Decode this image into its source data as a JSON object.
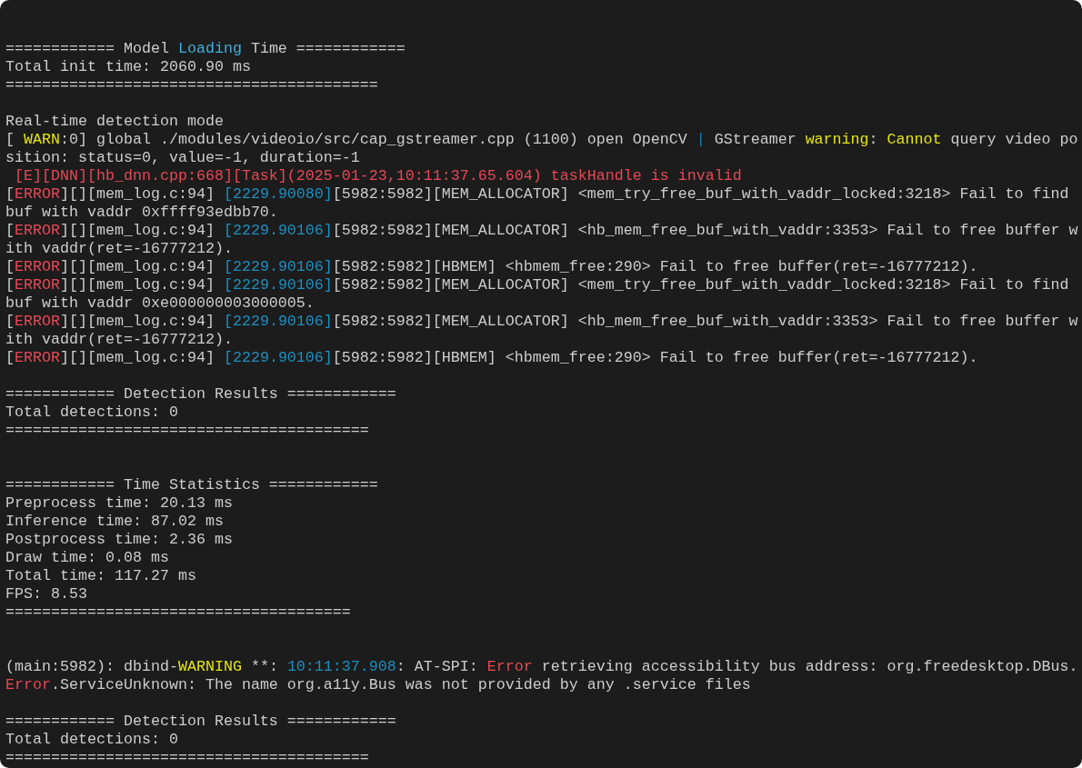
{
  "terminal": {
    "lines": [
      {
        "kind": "blank"
      },
      {
        "kind": "blank"
      },
      {
        "kind": "text",
        "segments": [
          {
            "text": "============ Model "
          },
          {
            "text": "Loading",
            "color": "#3fb0dc"
          },
          {
            "text": " Time ============"
          }
        ]
      },
      {
        "kind": "text",
        "segments": [
          {
            "text": "Total init time: 2060.90 ms"
          }
        ]
      },
      {
        "kind": "text",
        "segments": [
          {
            "text": "========================================="
          }
        ]
      },
      {
        "kind": "blank"
      },
      {
        "kind": "text",
        "segments": [
          {
            "text": "Real-time detection mode"
          }
        ]
      },
      {
        "kind": "text",
        "segments": [
          {
            "text": "[ "
          },
          {
            "text": "WARN",
            "color": "#e5e510"
          },
          {
            "text": ":0] global ./modules/videoio/src/cap_gstreamer.cpp (1100) open OpenCV "
          },
          {
            "text": "|",
            "color": "#1a7fb0"
          },
          {
            "text": " GStreamer "
          },
          {
            "text": "warning",
            "color": "#e5e510"
          },
          {
            "text": ": "
          },
          {
            "text": "Cannot",
            "color": "#e5e510"
          },
          {
            "text": " query video po"
          }
        ]
      },
      {
        "kind": "text",
        "segments": [
          {
            "text": "sition: status=0, value=-1, duration=-1"
          }
        ]
      },
      {
        "kind": "text",
        "segments": [
          {
            "text": " [E][DNN][hb_dnn.cpp:668][Task](2025-01-23,10:11:37.65.604) taskHandle is invalid",
            "color": "#e74856"
          }
        ]
      },
      {
        "kind": "text",
        "segments": [
          {
            "text": "["
          },
          {
            "text": "ERROR",
            "color": "#e74856"
          },
          {
            "text": "][][mem_log.c:94] "
          },
          {
            "text": "[2229.90080]",
            "color": "#1d8fbf"
          },
          {
            "text": "[5982:5982][MEM_ALLOCATOR] <mem_try_free_buf_with_vaddr_locked:3218> Fail to find"
          }
        ]
      },
      {
        "kind": "text",
        "segments": [
          {
            "text": "buf with vaddr 0xffff93edbb70."
          }
        ]
      },
      {
        "kind": "text",
        "segments": [
          {
            "text": "["
          },
          {
            "text": "ERROR",
            "color": "#e74856"
          },
          {
            "text": "][][mem_log.c:94] "
          },
          {
            "text": "[2229.90106]",
            "color": "#1d8fbf"
          },
          {
            "text": "[5982:5982][MEM_ALLOCATOR] <hb_mem_free_buf_with_vaddr:3353> Fail to free buffer w"
          }
        ]
      },
      {
        "kind": "text",
        "segments": [
          {
            "text": "ith vaddr(ret=-16777212)."
          }
        ]
      },
      {
        "kind": "text",
        "segments": [
          {
            "text": "["
          },
          {
            "text": "ERROR",
            "color": "#e74856"
          },
          {
            "text": "][][mem_log.c:94] "
          },
          {
            "text": "[2229.90106]",
            "color": "#1d8fbf"
          },
          {
            "text": "[5982:5982][HBMEM] <hbmem_free:290> Fail to free buffer(ret=-16777212)."
          }
        ]
      },
      {
        "kind": "text",
        "segments": [
          {
            "text": "["
          },
          {
            "text": "ERROR",
            "color": "#e74856"
          },
          {
            "text": "][][mem_log.c:94] "
          },
          {
            "text": "[2229.90106]",
            "color": "#1d8fbf"
          },
          {
            "text": "[5982:5982][MEM_ALLOCATOR] <mem_try_free_buf_with_vaddr_locked:3218> Fail to find"
          }
        ]
      },
      {
        "kind": "text",
        "segments": [
          {
            "text": "buf with vaddr 0xe000000003000005."
          }
        ]
      },
      {
        "kind": "text",
        "segments": [
          {
            "text": "["
          },
          {
            "text": "ERROR",
            "color": "#e74856"
          },
          {
            "text": "][][mem_log.c:94] "
          },
          {
            "text": "[2229.90106]",
            "color": "#1d8fbf"
          },
          {
            "text": "[5982:5982][MEM_ALLOCATOR] <hb_mem_free_buf_with_vaddr:3353> Fail to free buffer w"
          }
        ]
      },
      {
        "kind": "text",
        "segments": [
          {
            "text": "ith vaddr(ret=-16777212)."
          }
        ]
      },
      {
        "kind": "text",
        "segments": [
          {
            "text": "["
          },
          {
            "text": "ERROR",
            "color": "#e74856"
          },
          {
            "text": "][][mem_log.c:94] "
          },
          {
            "text": "[2229.90106]",
            "color": "#1d8fbf"
          },
          {
            "text": "[5982:5982][HBMEM] <hbmem_free:290> Fail to free buffer(ret=-16777212)."
          }
        ]
      },
      {
        "kind": "blank"
      },
      {
        "kind": "text",
        "segments": [
          {
            "text": "============ Detection Results ============"
          }
        ]
      },
      {
        "kind": "text",
        "segments": [
          {
            "text": "Total detections: 0"
          }
        ]
      },
      {
        "kind": "text",
        "segments": [
          {
            "text": "========================================"
          }
        ]
      },
      {
        "kind": "blank"
      },
      {
        "kind": "blank"
      },
      {
        "kind": "text",
        "segments": [
          {
            "text": "============ Time Statistics ============"
          }
        ]
      },
      {
        "kind": "text",
        "segments": [
          {
            "text": "Preprocess time: 20.13 ms"
          }
        ]
      },
      {
        "kind": "text",
        "segments": [
          {
            "text": "Inference time: 87.02 ms"
          }
        ]
      },
      {
        "kind": "text",
        "segments": [
          {
            "text": "Postprocess time: 2.36 ms"
          }
        ]
      },
      {
        "kind": "text",
        "segments": [
          {
            "text": "Draw time: 0.08 ms"
          }
        ]
      },
      {
        "kind": "text",
        "segments": [
          {
            "text": "Total time: 117.27 ms"
          }
        ]
      },
      {
        "kind": "text",
        "segments": [
          {
            "text": "FPS: 8.53"
          }
        ]
      },
      {
        "kind": "text",
        "segments": [
          {
            "text": "======================================"
          }
        ]
      },
      {
        "kind": "blank"
      },
      {
        "kind": "blank"
      },
      {
        "kind": "text",
        "segments": [
          {
            "text": "(main:5982): dbind-"
          },
          {
            "text": "WARNING",
            "color": "#e5e510"
          },
          {
            "text": " **: "
          },
          {
            "text": "10:11:37.908",
            "color": "#1d8fbf"
          },
          {
            "text": ": AT-SPI: "
          },
          {
            "text": "Error",
            "color": "#e74856"
          },
          {
            "text": " retrieving accessibility bus address: org.freedesktop.DBus."
          }
        ]
      },
      {
        "kind": "text",
        "segments": [
          {
            "text": "Error",
            "color": "#e74856"
          },
          {
            "text": ".ServiceUnknown: The name org.a11y.Bus was not provided by any .service files"
          }
        ]
      },
      {
        "kind": "blank"
      },
      {
        "kind": "text",
        "segments": [
          {
            "text": "============ Detection Results ============"
          }
        ]
      },
      {
        "kind": "text",
        "segments": [
          {
            "text": "Total detections: 0"
          }
        ]
      },
      {
        "kind": "text",
        "segments": [
          {
            "text": "========================================"
          }
        ]
      }
    ]
  }
}
